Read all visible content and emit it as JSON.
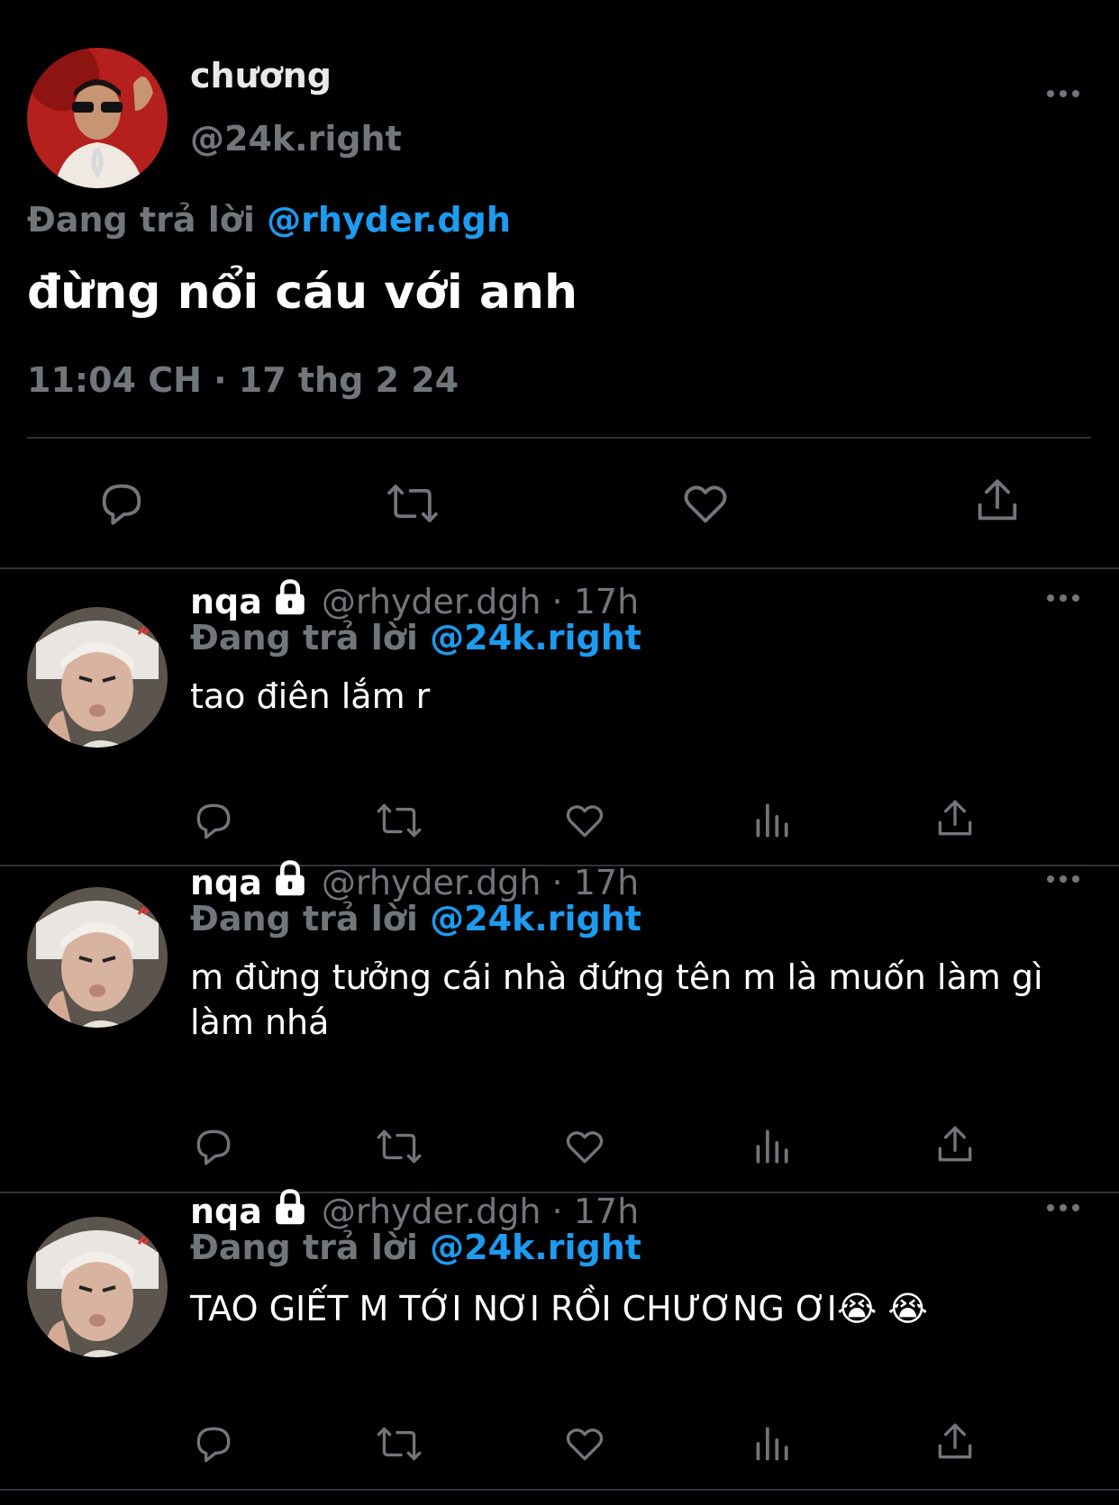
{
  "main_tweet": {
    "display_name": "chương",
    "handle": "@24k.right",
    "replying_prefix": "Đang trả lời",
    "replying_to": "@rhyder.dgh",
    "text": "đừng nổi cáu với anh",
    "timestamp": "11:04 CH · 17 thg 2 24",
    "avatar_icon": "avatar-photo-chuong",
    "actions": [
      "reply-icon",
      "retweet-icon",
      "like-icon",
      "share-icon"
    ]
  },
  "replies": [
    {
      "display_name": "nqa",
      "locked": true,
      "meta": "@rhyder.dgh · 17h",
      "replying_prefix": "Đang trả lời",
      "replying_to": "@24k.right",
      "text": "tao điên lắm r"
    },
    {
      "display_name": "nqa",
      "locked": true,
      "meta": "@rhyder.dgh · 17h",
      "replying_prefix": "Đang trả lời",
      "replying_to": "@24k.right",
      "text": "m đừng tưởng cái nhà đứng tên m là muốn làm gì làm nhá"
    },
    {
      "display_name": "nqa",
      "locked": true,
      "meta": "@rhyder.dgh · 17h",
      "replying_prefix": "Đang trả lời",
      "replying_to": "@24k.right",
      "text": "TAO GIẾT M TỚI NƠI RỒI CHƯƠNG ƠI😭 😭"
    }
  ],
  "colors": {
    "background": "#000000",
    "primary_text": "#e7e9ea",
    "secondary_text": "#71767b",
    "accent": "#1d9bf0",
    "divider": "#2f3336"
  }
}
